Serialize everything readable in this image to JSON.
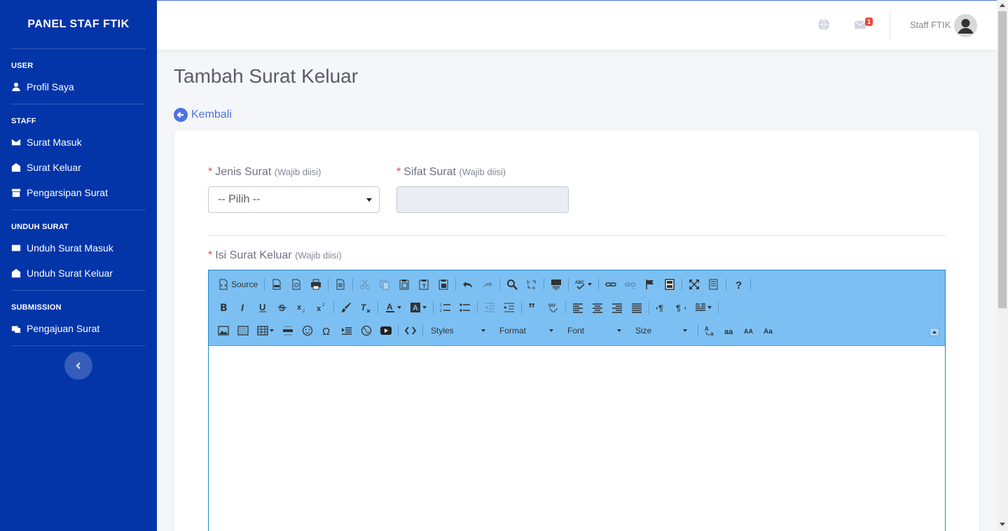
{
  "sidebar": {
    "brand": "PANEL STAF FTIK",
    "sections": [
      {
        "heading": "USER",
        "items": [
          {
            "label": "Profil Saya",
            "icon": "user-icon"
          }
        ]
      },
      {
        "heading": "STAFF",
        "items": [
          {
            "label": "Surat Masuk",
            "icon": "envelope-icon"
          },
          {
            "label": "Surat Keluar",
            "icon": "envelope-open-icon"
          },
          {
            "label": "Pengarsipan Surat",
            "icon": "archive-icon"
          }
        ]
      },
      {
        "heading": "UNDUH SURAT",
        "items": [
          {
            "label": "Unduh Surat Masuk",
            "icon": "envelope-icon"
          },
          {
            "label": "Unduh Surat Keluar",
            "icon": "envelope-open-icon"
          }
        ]
      },
      {
        "heading": "SUBMISSION",
        "items": [
          {
            "label": "Pengajuan Surat",
            "icon": "mail-bulk-icon"
          }
        ]
      }
    ]
  },
  "topbar": {
    "notification_count": "1",
    "user_name": "Staff FTIK"
  },
  "page": {
    "title": "Tambah Surat Keluar",
    "back_label": "Kembali"
  },
  "form": {
    "jenis_label": "Jenis Surat",
    "jenis_hint": "(Wajib diisi)",
    "jenis_value": "-- Pilih --",
    "sifat_label": "Sifat Surat",
    "sifat_hint": "(Wajib diisi)",
    "sifat_value": "",
    "isi_label": "Isi Surat Keluar",
    "isi_hint": "(Wajib diisi)",
    "required_mark": "*"
  },
  "editor": {
    "source_label": "Source",
    "combos": [
      "Styles",
      "Format",
      "Font",
      "Size"
    ],
    "colors": {
      "toolbar": "#7cc0f3",
      "border": "#1e88c7"
    }
  },
  "colors": {
    "sidebar": "#0335a8",
    "accent": "#4e73df",
    "required": "#e74a3b"
  }
}
